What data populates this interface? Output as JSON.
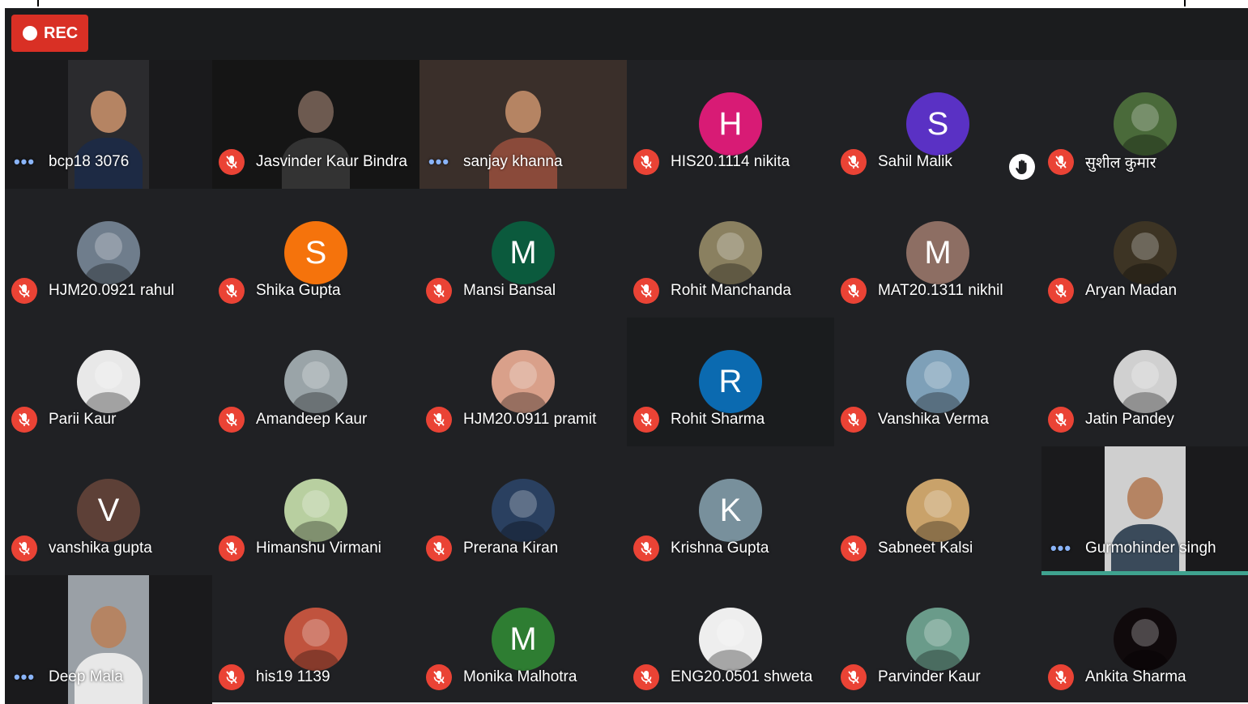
{
  "recording": {
    "label": "REC"
  },
  "colors": {
    "background": "#202124",
    "mute": "#ea4335",
    "rec": "#d93025",
    "speaking": "#3fa38f"
  },
  "participants": [
    {
      "name": "bcp18 3076",
      "status": "more",
      "kind": "video",
      "bg": "#2b2b2e"
    },
    {
      "name": "Jasvinder Kaur Bindra",
      "status": "muted",
      "kind": "video",
      "bg": "#151515"
    },
    {
      "name": "sanjay khanna",
      "status": "more",
      "kind": "video",
      "bg": "#3a2f2a"
    },
    {
      "name": "HIS20.1114 nikita",
      "status": "muted",
      "kind": "letter",
      "letter": "H",
      "color": "#d81b75"
    },
    {
      "name": "Sahil Malik",
      "status": "muted",
      "kind": "letter",
      "letter": "S",
      "color": "#5a31c4",
      "hand_icon": "raised-hand-icon"
    },
    {
      "name": "सुशील कुमार",
      "status": "muted",
      "kind": "photo",
      "color": "#4a6a3a"
    },
    {
      "name": "HJM20.0921 rahul",
      "status": "muted",
      "kind": "photo",
      "color": "#6f7d8c"
    },
    {
      "name": "Shika Gupta",
      "status": "muted",
      "kind": "letter",
      "letter": "S",
      "color": "#f5730c"
    },
    {
      "name": "Mansi Bansal",
      "status": "muted",
      "kind": "letter",
      "letter": "M",
      "color": "#0b5a3d"
    },
    {
      "name": "Rohit Manchanda",
      "status": "muted",
      "kind": "photo",
      "color": "#8a8060"
    },
    {
      "name": "MAT20.1311 nikhil",
      "status": "muted",
      "kind": "letter",
      "letter": "M",
      "color": "#8d6e63"
    },
    {
      "name": "Aryan Madan",
      "status": "muted",
      "kind": "photo",
      "color": "#3d3424"
    },
    {
      "name": "Parii Kaur",
      "status": "muted",
      "kind": "photo",
      "color": "#e8e8e8"
    },
    {
      "name": "Amandeep Kaur",
      "status": "muted",
      "kind": "photo",
      "color": "#9aa4a8"
    },
    {
      "name": "HJM20.0911 pramit",
      "status": "muted",
      "kind": "photo",
      "color": "#d9a08a"
    },
    {
      "name": "Rohit Sharma",
      "status": "muted",
      "kind": "letter",
      "letter": "R",
      "color": "#0b6ab0",
      "highlight": true
    },
    {
      "name": "Vanshika Verma",
      "status": "muted",
      "kind": "photo",
      "color": "#7ea0b8"
    },
    {
      "name": "Jatin Pandey",
      "status": "muted",
      "kind": "photo",
      "color": "#d0d0d0"
    },
    {
      "name": "vanshika gupta",
      "status": "muted",
      "kind": "letter",
      "letter": "V",
      "color": "#5d4037"
    },
    {
      "name": "Himanshu Virmani",
      "status": "muted",
      "kind": "photo",
      "color": "#b8cfa0"
    },
    {
      "name": "Prerana Kiran",
      "status": "muted",
      "kind": "photo",
      "color": "#2a4060"
    },
    {
      "name": "Krishna Gupta",
      "status": "muted",
      "kind": "letter",
      "letter": "K",
      "color": "#78909c"
    },
    {
      "name": "Sabneet Kalsi",
      "status": "muted",
      "kind": "photo",
      "color": "#c9a26a"
    },
    {
      "name": "Gurmohinder singh",
      "status": "more",
      "kind": "video",
      "bg": "#cfcfcf",
      "speaking": true
    },
    {
      "name": "Deep Mala",
      "status": "more",
      "kind": "video",
      "bg": "#9aa0a6"
    },
    {
      "name": "his19 1139",
      "status": "muted",
      "kind": "photo",
      "color": "#c0533e"
    },
    {
      "name": "Monika Malhotra",
      "status": "muted",
      "kind": "letter",
      "letter": "M",
      "color": "#2e7d32"
    },
    {
      "name": "ENG20.0501 shweta",
      "status": "muted",
      "kind": "photo",
      "color": "#eeeeee"
    },
    {
      "name": "Parvinder Kaur",
      "status": "muted",
      "kind": "photo",
      "color": "#6a9b8a"
    },
    {
      "name": "Ankita Sharma",
      "status": "muted",
      "kind": "photo",
      "color": "#100a0c"
    }
  ]
}
